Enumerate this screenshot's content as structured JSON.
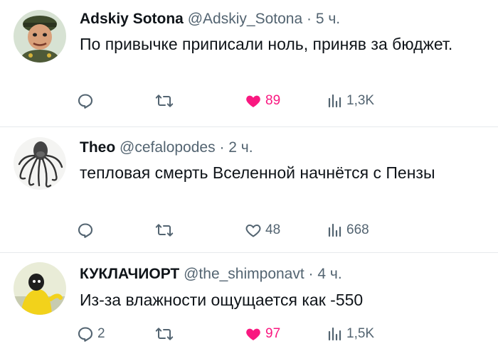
{
  "tweets": [
    {
      "author_name": "Adskiy Sotona",
      "handle": "@Adskiy_Sotona",
      "separator": "·",
      "time": "5 ч.",
      "text": "По привычке приписали ноль, приняв за бюджет.",
      "replies": "",
      "retweets": "",
      "likes": "89",
      "liked": true,
      "views": "1,3K",
      "avatar_icon": "cartoon-general-avatar"
    },
    {
      "author_name": "Theo",
      "handle": "@cefalopodes",
      "separator": "·",
      "time": "2 ч.",
      "text": "тепловая смерть Вселенной начнётся с Пензы",
      "replies": "",
      "retweets": "",
      "likes": "48",
      "liked": false,
      "views": "668",
      "avatar_icon": "octopus-drawing-avatar"
    },
    {
      "author_name": "КУКЛАЧИОРТ",
      "handle": "@the_shimponavt",
      "separator": "·",
      "time": "4 ч.",
      "text": "Из-за влажности ощущается как -550",
      "replies": "2",
      "retweets": "",
      "likes": "97",
      "liked": true,
      "views": "1,5K",
      "avatar_icon": "yellow-figure-avatar"
    }
  ],
  "colors": {
    "text_primary": "#0f1419",
    "text_secondary": "#536471",
    "like_active": "#f91880",
    "divider": "#e6e9ec"
  },
  "icons": {
    "reply": "reply-icon",
    "retweet": "retweet-icon",
    "like": "heart-icon",
    "views": "views-chart-icon"
  }
}
